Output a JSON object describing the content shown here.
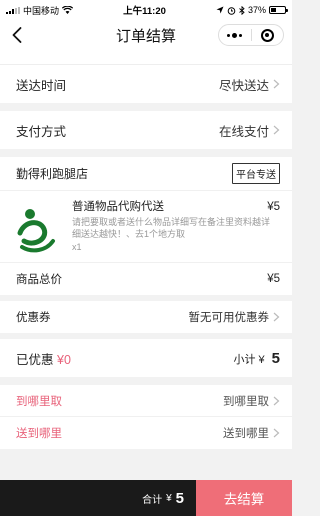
{
  "status": {
    "carrier": "中国移动",
    "time": "上午11:20",
    "battery": "37%",
    "battery_level": 0.37
  },
  "nav": {
    "title": "订单结算"
  },
  "delivery": {
    "label": "送达时间",
    "value": "尽快送达"
  },
  "payment": {
    "label": "支付方式",
    "value": "在线支付"
  },
  "shop": {
    "name": "勤得利跑腿店",
    "badge": "平台专送"
  },
  "product": {
    "name": "普通物品代购代送",
    "price": "¥5",
    "desc": "请把要取或者送什么物品详细写在备注里资料越详细送达越快！、去1个地方取",
    "qty": "x1",
    "logo_color": "#1a7a2e"
  },
  "goods_total": {
    "label": "商品总价",
    "value": "¥5"
  },
  "coupon": {
    "label": "优惠券",
    "value": "暂无可用优惠券"
  },
  "discount": {
    "label": "已优惠",
    "value": "¥0",
    "subtotal_label": "小计",
    "subtotal_currency": "¥",
    "subtotal_value": "5"
  },
  "pickup": {
    "label": "到哪里取",
    "value": "到哪里取"
  },
  "dropoff": {
    "label": "送到哪里",
    "value": "送到哪里"
  },
  "footer": {
    "total_label": "合计",
    "currency": "¥",
    "total_value": "5",
    "checkout_label": "去结算"
  },
  "colors": {
    "accent": "#e8627a",
    "checkout_bg": "#ef6e78",
    "footer_bg": "#1a1a1a"
  }
}
